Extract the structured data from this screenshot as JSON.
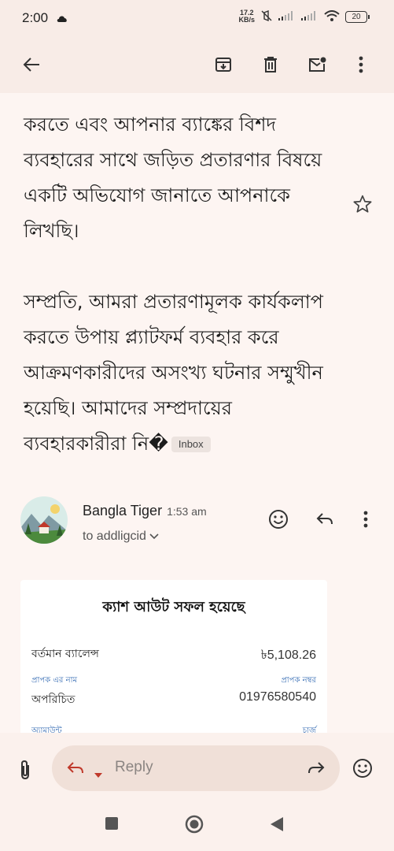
{
  "status": {
    "time": "2:00",
    "net_speed_value": "17.2",
    "net_speed_unit": "KB/s",
    "battery": "20"
  },
  "email": {
    "paragraph1": "করতে এবং আপনার ব্যাঙ্কের বিশদ ব্যবহারের সাথে জড়িত প্রতারণার বিষয়ে একটি অভিযোগ জানাতে আপনাকে লিখছি।",
    "paragraph2": "সম্প্রতি, আমরা প্রতারণামূলক কার্যকলাপ করতে উপায় প্ল্যাটফর্ম ব্যবহার করে আক্রমণকারীদের অসংখ্য ঘটনার সম্মুখীন হয়েছি। আমাদের সম্প্রদায়ের ব্যবহারকারীরা নি�",
    "label_chip": "Inbox"
  },
  "sender": {
    "name": "Bangla Tiger",
    "time": "1:53 am",
    "to": "to addligcid"
  },
  "receipt": {
    "title": "ক্যাশ আউট সফল হয়েছে",
    "balance_label": "বর্তমান ব্যালেন্স",
    "balance_value": "৳5,108.26",
    "recipient_name_label": "প্রাপক এর নাম",
    "recipient_number_label": "প্রাপক নম্বর",
    "recipient_name": "অপরিচিত",
    "recipient_number": "01976580540",
    "amount_label": "অ্যামাউন্ট",
    "charge_label": "চার্জ"
  },
  "reply_bar": {
    "placeholder": "Reply"
  },
  "colors": {
    "background": "#fbf1ed",
    "reply_box": "#f0e0d8",
    "link_blue": "#3a6fb5"
  }
}
